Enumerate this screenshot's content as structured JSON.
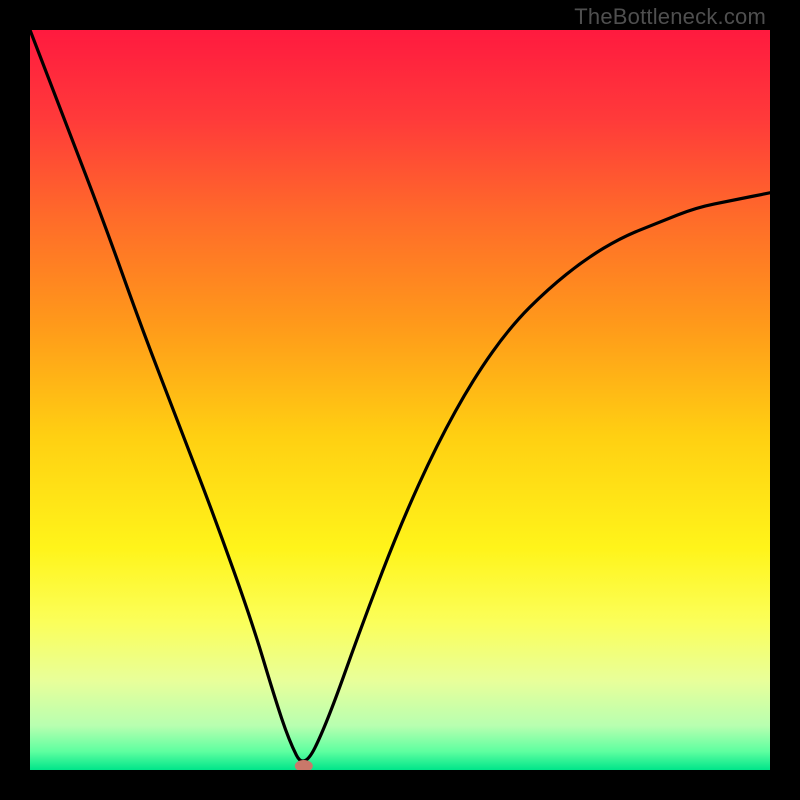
{
  "watermark": {
    "text": "TheBottleneck.com"
  },
  "gradient": {
    "stops": [
      {
        "offset": 0.0,
        "color": "#ff1a3f"
      },
      {
        "offset": 0.12,
        "color": "#ff3a3a"
      },
      {
        "offset": 0.25,
        "color": "#ff6a2a"
      },
      {
        "offset": 0.4,
        "color": "#ff9a1a"
      },
      {
        "offset": 0.55,
        "color": "#ffd012"
      },
      {
        "offset": 0.7,
        "color": "#fff41a"
      },
      {
        "offset": 0.8,
        "color": "#fbff5a"
      },
      {
        "offset": 0.88,
        "color": "#e8ff9a"
      },
      {
        "offset": 0.94,
        "color": "#b8ffb0"
      },
      {
        "offset": 0.975,
        "color": "#5effa0"
      },
      {
        "offset": 1.0,
        "color": "#00e58a"
      }
    ]
  },
  "marker": {
    "x_frac": 0.37,
    "color": "#c9786a",
    "rx": 9,
    "ry": 6
  },
  "chart_data": {
    "type": "line",
    "title": "",
    "xlabel": "",
    "ylabel": "",
    "xlim": [
      0,
      1
    ],
    "ylim": [
      0,
      100
    ],
    "annotations": [
      "TheBottleneck.com"
    ],
    "series": [
      {
        "name": "curve",
        "x": [
          0.0,
          0.05,
          0.1,
          0.15,
          0.2,
          0.25,
          0.3,
          0.33,
          0.35,
          0.37,
          0.4,
          0.45,
          0.5,
          0.55,
          0.6,
          0.65,
          0.7,
          0.75,
          0.8,
          0.85,
          0.9,
          0.95,
          1.0
        ],
        "values": [
          100,
          87,
          74,
          60,
          47,
          34,
          20,
          10,
          4,
          0,
          6,
          20,
          33,
          44,
          53,
          60,
          65,
          69,
          72,
          74,
          76,
          77,
          78
        ]
      }
    ],
    "marker_point": {
      "x": 0.37,
      "value": 0
    }
  }
}
